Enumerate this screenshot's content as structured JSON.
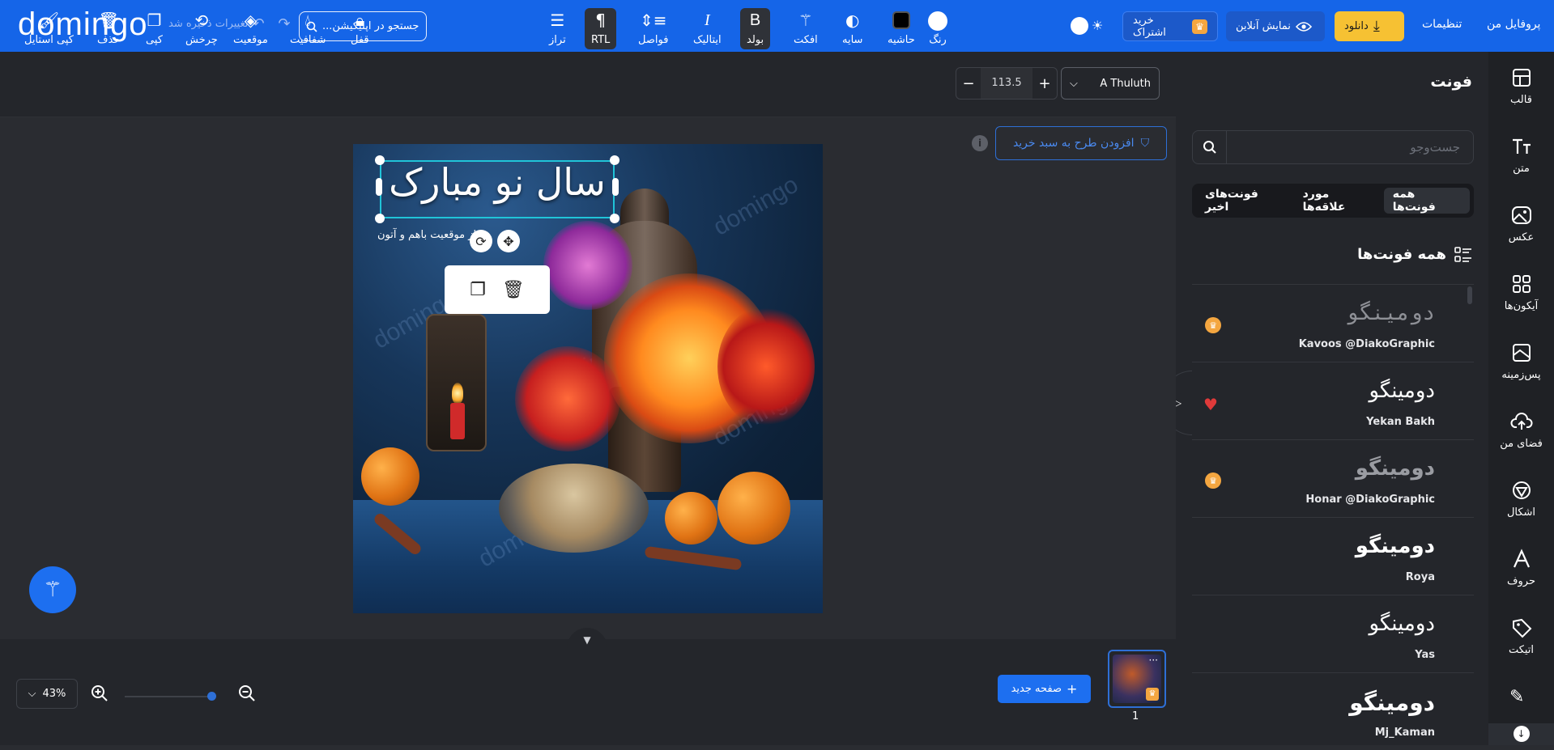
{
  "topbar": {
    "logo": "domingo",
    "saved_status": "تغییرات ذخیره شد",
    "search_text": "جستجو در اپلیکیشن...",
    "subscribe_label": "خرید اشتراک",
    "preview_label": "نمایش آنلاین",
    "download_label": "دانلود",
    "settings_label": "تنظیمات",
    "profile_label": "پروفایل من"
  },
  "rail": {
    "items": [
      {
        "label": "قالب",
        "icon": "template-icon"
      },
      {
        "label": "متن",
        "icon": "text-icon"
      },
      {
        "label": "عکس",
        "icon": "photo-icon"
      },
      {
        "label": "آیکون‌ها",
        "icon": "icons-grid-icon"
      },
      {
        "label": "پس‌زمینه",
        "icon": "background-icon"
      },
      {
        "label": "فضای من",
        "icon": "cloud-upload-icon"
      },
      {
        "label": "اشکال",
        "icon": "shapes-icon"
      },
      {
        "label": "حروف",
        "icon": "letters-icon"
      },
      {
        "label": "اتیکت",
        "icon": "sticker-tag-icon"
      }
    ]
  },
  "panel": {
    "title": "فونت",
    "search_placeholder": "جست‌وجو",
    "tabs": [
      "همه فونت‌ها",
      "مورد علاقه‌ها",
      "فونت‌های اخیر"
    ],
    "section_title": "همه فونت‌ها",
    "fonts": [
      {
        "preview": "دومینگو",
        "name": "Kavoos @DiakoGraphic",
        "badge": "premium"
      },
      {
        "preview": "دومینگو",
        "name": "Yekan Bakh",
        "badge": "favorite"
      },
      {
        "preview": "دومینگو",
        "name": "Honar @DiakoGraphic",
        "badge": "premium"
      },
      {
        "preview": "دومینگو",
        "name": "Roya",
        "badge": ""
      },
      {
        "preview": "دومینگو",
        "name": "Yas",
        "badge": ""
      },
      {
        "preview": "دومینگو",
        "name": "Mj_Kaman",
        "badge": ""
      }
    ]
  },
  "toolbar": {
    "font_name": "A Thuluth",
    "font_size": "113.5",
    "tools": [
      {
        "label": "رنگ"
      },
      {
        "label": "حاشیه"
      },
      {
        "label": "سایه"
      },
      {
        "label": "افکت"
      },
      {
        "label": "بولد"
      },
      {
        "label": "ایتالیک"
      },
      {
        "label": "فواصل"
      },
      {
        "label": "RTL"
      },
      {
        "label": "تراز"
      },
      {
        "label": "قفل"
      },
      {
        "label": "شفافیت"
      },
      {
        "label": "موقعیت"
      },
      {
        "label": "چرخش"
      },
      {
        "label": "کپی"
      },
      {
        "label": "حذف"
      },
      {
        "label": "کپی استایل"
      }
    ]
  },
  "canvas": {
    "add_to_cart": "افزودن طرح به سبد خرید",
    "title_text": "سال نو مبارک",
    "subtitle_text": "از موقعیت باهم و آتون",
    "watermark": "domingo"
  },
  "bottom": {
    "zoom": "43%",
    "new_page": "صفحه جدید",
    "page_number": "1"
  },
  "colors": {
    "brand_blue": "#1565e8",
    "download_yellow": "#f6c133",
    "panel_bg": "#24262b",
    "workspace_bg": "#2a2c31"
  }
}
